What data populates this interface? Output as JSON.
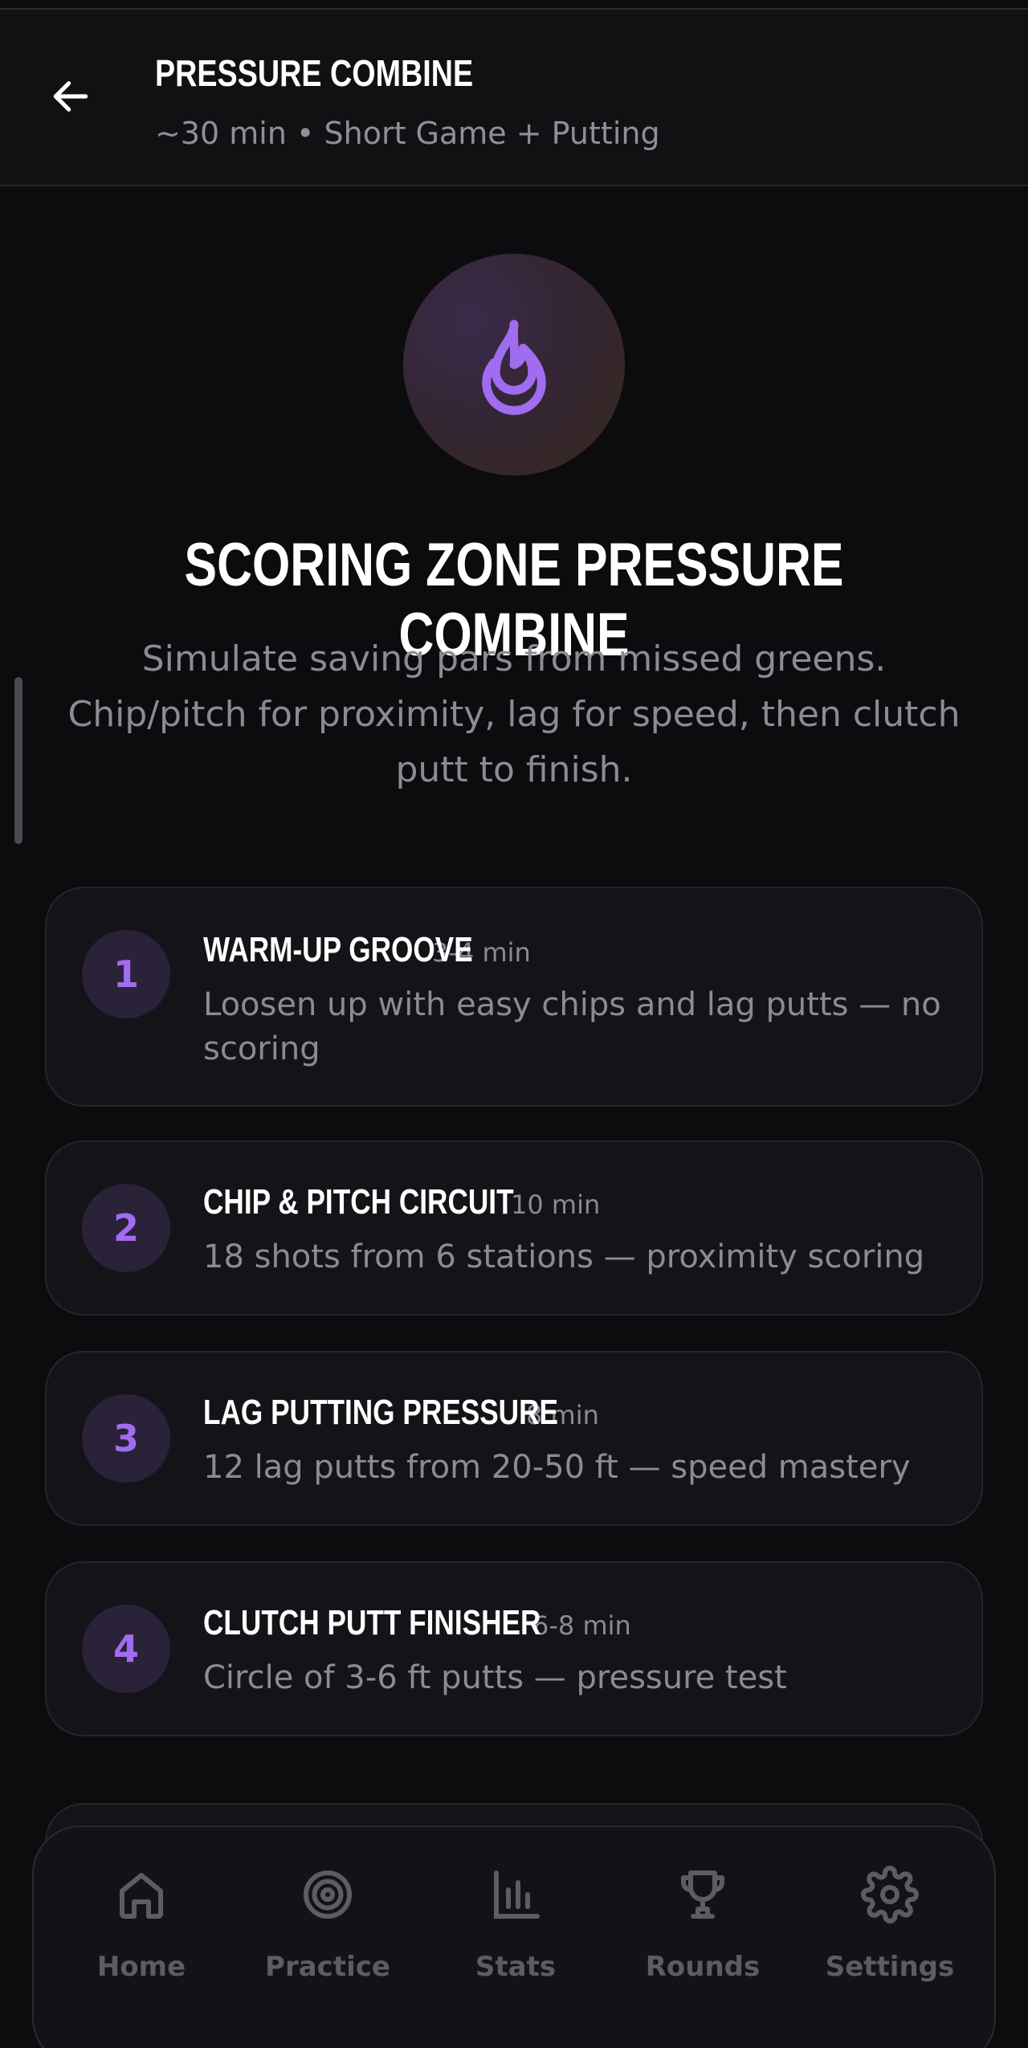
{
  "header": {
    "title": "PRESSURE COMBINE",
    "subtitle": "~30 min • Short Game + Putting",
    "back_icon": "arrow-left-icon"
  },
  "hero": {
    "icon": "flame-icon",
    "title": "SCORING ZONE PRESSURE COMBINE",
    "description": "Simulate saving pars from missed greens. Chip/pitch for proximity, lag for speed, then clutch putt to finish.",
    "accent_color": "#a06cf0"
  },
  "steps": [
    {
      "number": "1",
      "title": "WARM-UP GROOVE",
      "time": "3-4 min",
      "description": "Loosen up with easy chips and lag putts — no scoring"
    },
    {
      "number": "2",
      "title": "CHIP & PITCH CIRCUIT",
      "time": "10 min",
      "description": "18 shots from 6 stations — proximity scoring"
    },
    {
      "number": "3",
      "title": "LAG PUTTING PRESSURE",
      "time": "8 min",
      "description": "12 lag putts from 20-50 ft — speed mastery"
    },
    {
      "number": "4",
      "title": "CLUTCH PUTT FINISHER",
      "time": "6-8 min",
      "description": "Circle of 3-6 ft putts — pressure test"
    }
  ],
  "nav": {
    "items": [
      {
        "label": "Home",
        "icon": "home-icon"
      },
      {
        "label": "Practice",
        "icon": "target-icon"
      },
      {
        "label": "Stats",
        "icon": "bar-chart-icon"
      },
      {
        "label": "Rounds",
        "icon": "trophy-icon"
      },
      {
        "label": "Settings",
        "icon": "gear-icon"
      }
    ],
    "inactive_color": "#5c5c66"
  }
}
